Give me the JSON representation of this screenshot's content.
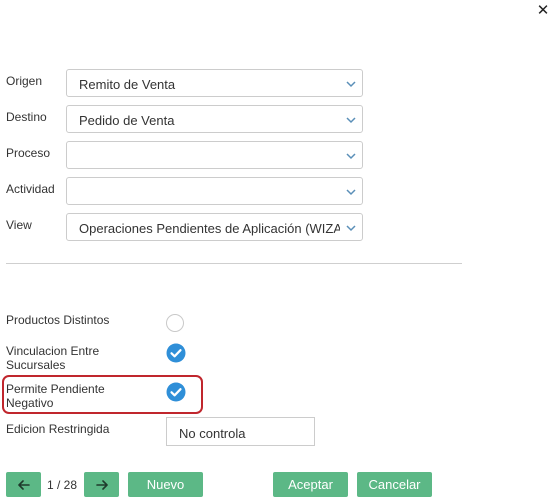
{
  "dialog": {
    "close_symbol": "✕"
  },
  "fields": {
    "origen": {
      "label": "Origen",
      "value": "Remito de Venta"
    },
    "destino": {
      "label": "Destino",
      "value": "Pedido de Venta"
    },
    "proceso": {
      "label": "Proceso",
      "value": ""
    },
    "actividad": {
      "label": "Actividad",
      "value": ""
    },
    "view": {
      "label": "View",
      "value": "Operaciones Pendientes de Aplicación (WIZARD)"
    }
  },
  "options": {
    "productos_distintos": {
      "label": "Productos Distintos",
      "checked": false
    },
    "vinculacion": {
      "label_line1": "Vinculacion Entre",
      "label_line2": "Sucursales",
      "checked": true
    },
    "permite_pendiente": {
      "label_line1": "Permite Pendiente",
      "label_line2": "Negativo",
      "checked": true
    },
    "edicion_restringida": {
      "label": "Edicion Restringida",
      "value": "No controla"
    }
  },
  "footer": {
    "pager": "1 / 28",
    "nuevo": "Nuevo",
    "aceptar": "Aceptar",
    "cancelar": "Cancelar"
  },
  "colors": {
    "accent": "#5cb886",
    "check": "#2f8fd8",
    "highlight": "#c0262d"
  },
  "icons": [
    "close-icon",
    "chevron-down-icon",
    "arrow-left-icon",
    "arrow-right-icon",
    "check-circle-icon"
  ]
}
